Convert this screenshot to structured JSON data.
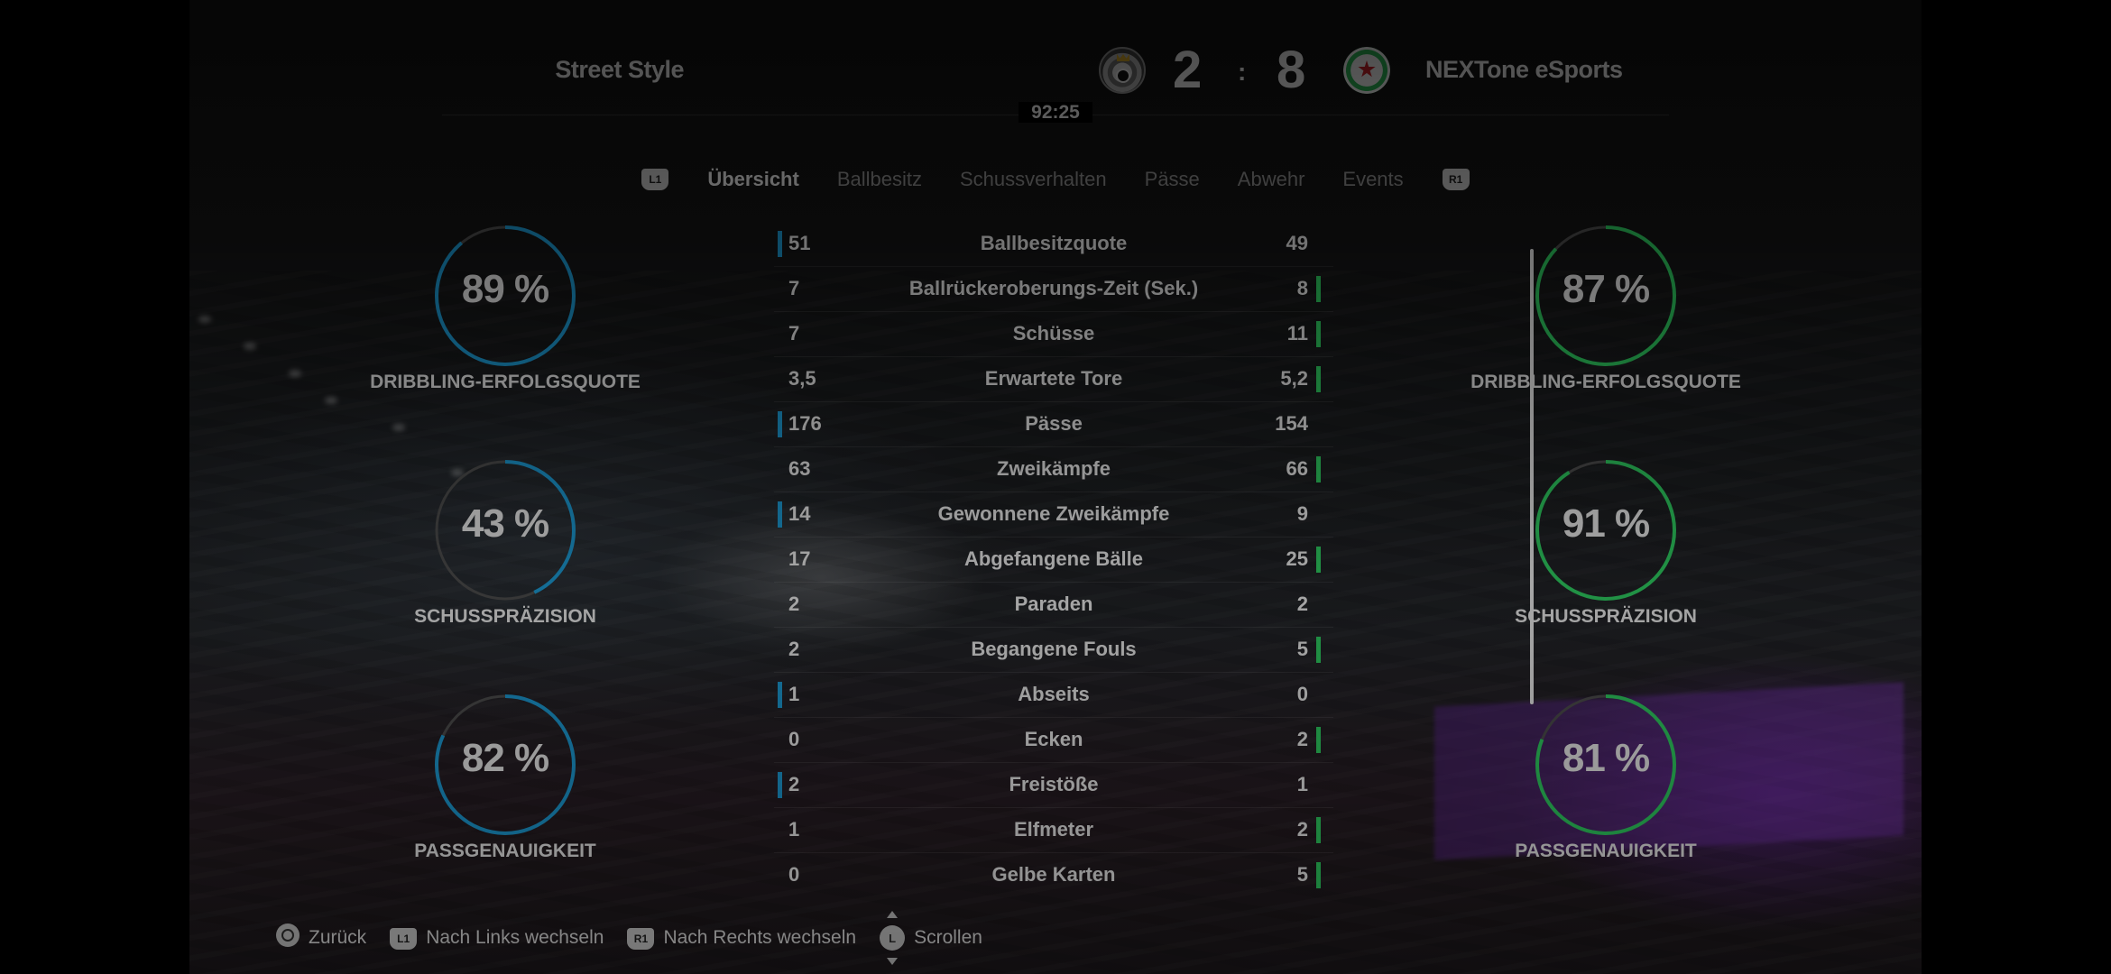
{
  "header": {
    "home_team": "Street Style",
    "away_team": "NEXTone eSports",
    "home_score": "2",
    "away_score": "8",
    "separator": ":",
    "clock": "92:25"
  },
  "tabs": {
    "left_button": "L1",
    "right_button": "R1",
    "items": [
      "Übersicht",
      "Ballbesitz",
      "Schussverhalten",
      "Pässe",
      "Abwehr",
      "Events"
    ],
    "active": "Übersicht"
  },
  "gauges": {
    "home": [
      {
        "value_text": "89 %",
        "percent": 89,
        "label": "DRIBBLING-ERFOLGSQUOTE"
      },
      {
        "value_text": "43 %",
        "percent": 43,
        "label": "SCHUSSPRÄZISION"
      },
      {
        "value_text": "82 %",
        "percent": 82,
        "label": "PASSGENAUIGKEIT"
      }
    ],
    "away": [
      {
        "value_text": "87 %",
        "percent": 87,
        "label": "DRIBBLING-ERFOLGSQUOTE"
      },
      {
        "value_text": "91 %",
        "percent": 91,
        "label": "SCHUSSPRÄZISION"
      },
      {
        "value_text": "81 %",
        "percent": 81,
        "label": "PASSGENAUIGKEIT"
      }
    ],
    "home_color": "#1fa8e6",
    "away_color": "#33e06a"
  },
  "stats": [
    {
      "name": "Ballbesitzquote",
      "home": "51",
      "away": "49",
      "leader": "home"
    },
    {
      "name": "Ballrückeroberungs-Zeit (Sek.)",
      "home": "7",
      "away": "8",
      "leader": "away"
    },
    {
      "name": "Schüsse",
      "home": "7",
      "away": "11",
      "leader": "away"
    },
    {
      "name": "Erwartete Tore",
      "home": "3,5",
      "away": "5,2",
      "leader": "away"
    },
    {
      "name": "Pässe",
      "home": "176",
      "away": "154",
      "leader": "home"
    },
    {
      "name": "Zweikämpfe",
      "home": "63",
      "away": "66",
      "leader": "away"
    },
    {
      "name": "Gewonnene Zweikämpfe",
      "home": "14",
      "away": "9",
      "leader": "home"
    },
    {
      "name": "Abgefangene Bälle",
      "home": "17",
      "away": "25",
      "leader": "away"
    },
    {
      "name": "Paraden",
      "home": "2",
      "away": "2",
      "leader": "none"
    },
    {
      "name": "Begangene Fouls",
      "home": "2",
      "away": "5",
      "leader": "away"
    },
    {
      "name": "Abseits",
      "home": "1",
      "away": "0",
      "leader": "home"
    },
    {
      "name": "Ecken",
      "home": "0",
      "away": "2",
      "leader": "away"
    },
    {
      "name": "Freistöße",
      "home": "2",
      "away": "1",
      "leader": "home"
    },
    {
      "name": "Elfmeter",
      "home": "1",
      "away": "2",
      "leader": "away"
    },
    {
      "name": "Gelbe Karten",
      "home": "0",
      "away": "5",
      "leader": "away"
    }
  ],
  "footer": {
    "back_label": "Zurück",
    "l1_badge": "L1",
    "left_label": "Nach Links wechseln",
    "r1_badge": "R1",
    "right_label": "Nach Rechts wechseln",
    "stick_badge": "L",
    "scroll_label": "Scrollen"
  }
}
